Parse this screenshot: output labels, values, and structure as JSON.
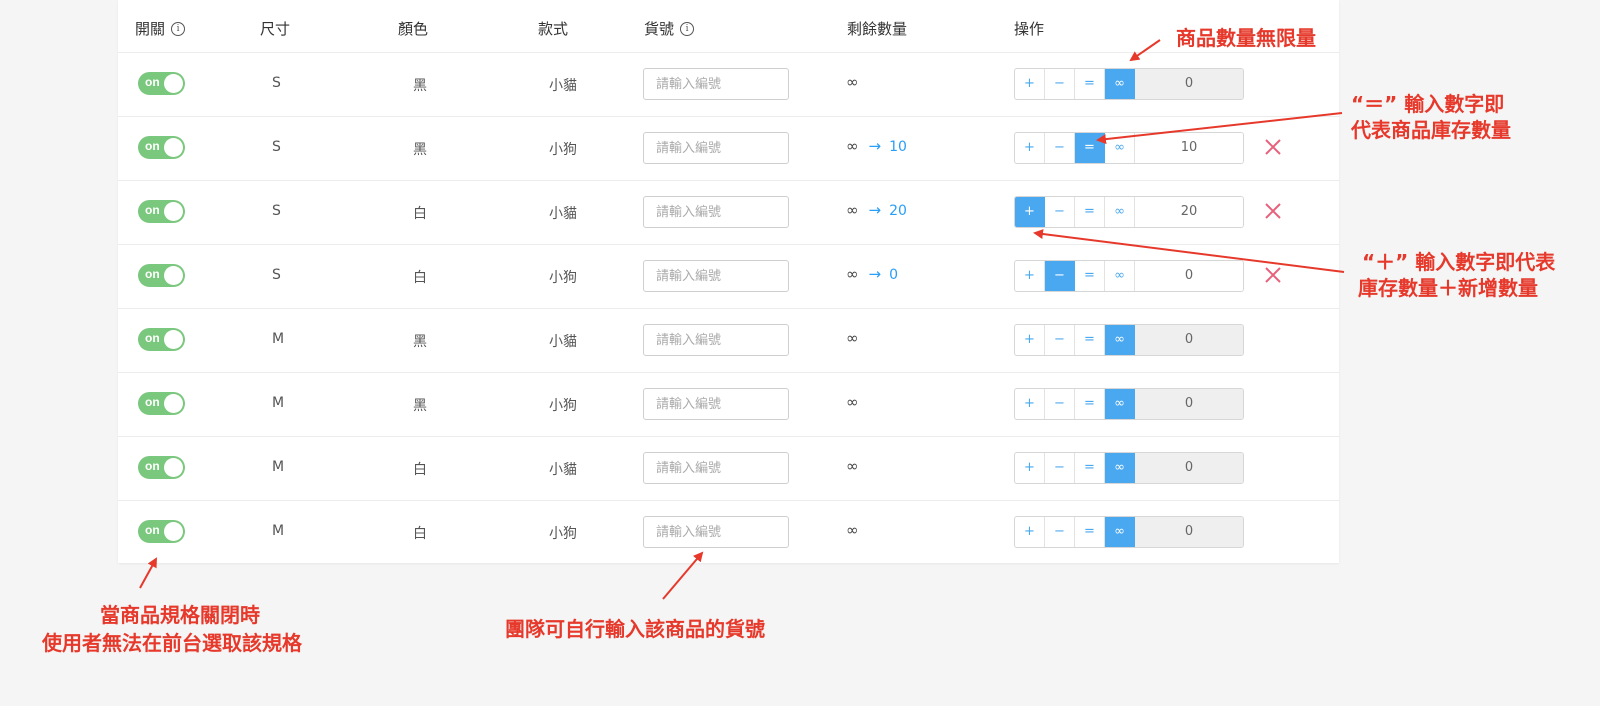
{
  "headers": {
    "switch": "開關",
    "size": "尺寸",
    "color": "顏色",
    "style": "款式",
    "sku": "貨號",
    "remaining": "剩餘數量",
    "actions": "操作"
  },
  "info_icon": "i",
  "toggle_label": "on",
  "sku_placeholder": "請輸入編號",
  "op_labels": {
    "plus": "+",
    "minus": "−",
    "equal": "=",
    "infinite": "∞"
  },
  "rows": [
    {
      "size": "S",
      "color": "黑",
      "style": "小貓",
      "remain": "∞",
      "arrow": "",
      "target": "",
      "active_op": "infinite",
      "qty": "0",
      "deletable": false
    },
    {
      "size": "S",
      "color": "黑",
      "style": "小狗",
      "remain": "∞",
      "arrow": "→",
      "target": "10",
      "active_op": "equal",
      "qty": "10",
      "deletable": true
    },
    {
      "size": "S",
      "color": "白",
      "style": "小貓",
      "remain": "∞",
      "arrow": "→",
      "target": "20",
      "active_op": "plus",
      "qty": "20",
      "deletable": true
    },
    {
      "size": "S",
      "color": "白",
      "style": "小狗",
      "remain": "∞",
      "arrow": "→",
      "target": "0",
      "active_op": "minus",
      "qty": "0",
      "deletable": true
    },
    {
      "size": "M",
      "color": "黑",
      "style": "小貓",
      "remain": "∞",
      "arrow": "",
      "target": "",
      "active_op": "infinite",
      "qty": "0",
      "deletable": false
    },
    {
      "size": "M",
      "color": "黑",
      "style": "小狗",
      "remain": "∞",
      "arrow": "",
      "target": "",
      "active_op": "infinite",
      "qty": "0",
      "deletable": false
    },
    {
      "size": "M",
      "color": "白",
      "style": "小貓",
      "remain": "∞",
      "arrow": "",
      "target": "",
      "active_op": "infinite",
      "qty": "0",
      "deletable": false
    },
    {
      "size": "M",
      "color": "白",
      "style": "小狗",
      "remain": "∞",
      "arrow": "",
      "target": "",
      "active_op": "infinite",
      "qty": "0",
      "deletable": false
    }
  ],
  "annotations": {
    "unlimited": "商品數量無限量",
    "equal_line1": "“＝” 輸入數字即",
    "equal_line2": "代表商品庫存數量",
    "plus_line1": "“＋” 輸入數字即代表",
    "plus_line2": "庫存數量＋新增數量",
    "toggle_line1": "當商品規格關閉時",
    "toggle_line2": "使用者無法在前台選取該規格",
    "sku_note": "團隊可自行輸入該商品的貨號"
  },
  "colors": {
    "accent": "#4aa8f0",
    "toggle_on": "#7ac77e",
    "annotation": "#e6392b",
    "delete": "#e8607c"
  }
}
